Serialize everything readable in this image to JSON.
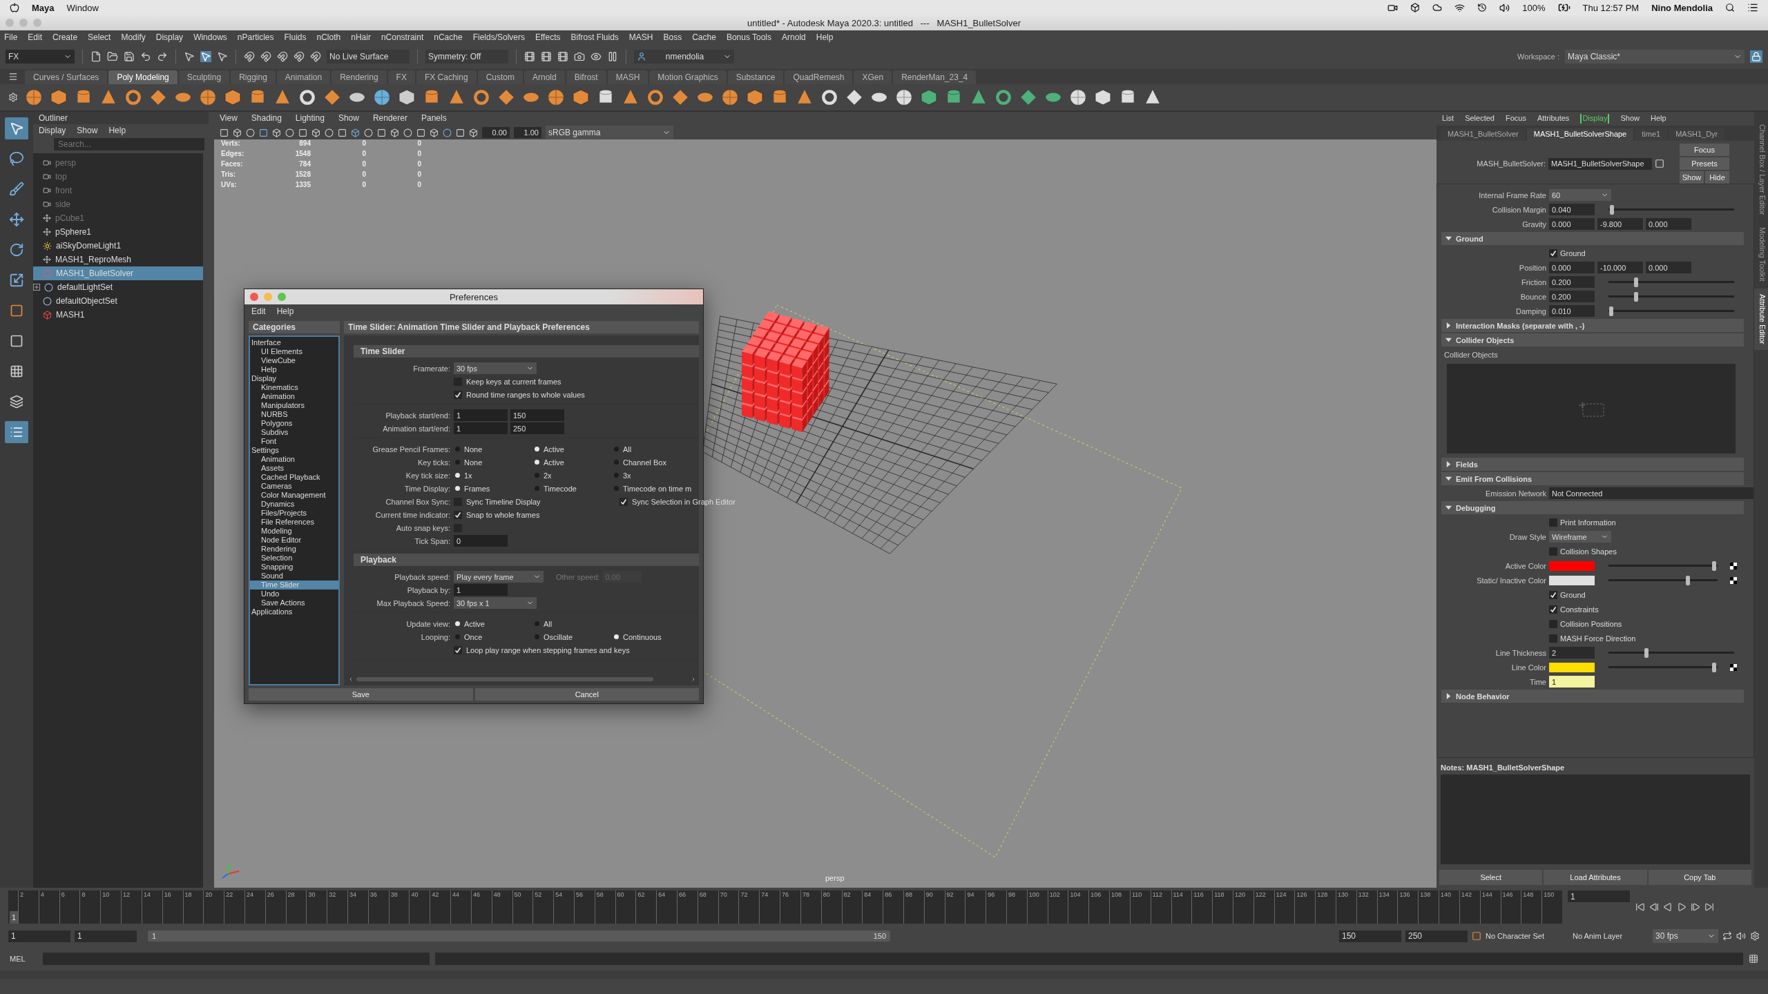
{
  "mac_menubar": {
    "app": "Maya",
    "menus": [
      "Window"
    ],
    "battery": "100%",
    "clock": "Thu 12:57 PM",
    "user": "Nino Mendolia"
  },
  "window": {
    "title": "untitled* - Autodesk Maya 2020.3: untitled   ---   MASH1_BulletSolver"
  },
  "menu_bar": [
    "File",
    "Edit",
    "Create",
    "Select",
    "Modify",
    "Display",
    "Windows",
    "nParticles",
    "Fluids",
    "nCloth",
    "nHair",
    "nConstraint",
    "nCache",
    "Fields/Solvers",
    "Effects",
    "Bifrost Fluids",
    "MASH",
    "Boss",
    "Cache",
    "Bonus Tools",
    "Arnold",
    "Help"
  ],
  "status_line": {
    "menu_set": "FX",
    "live_surface": "No Live Surface",
    "symmetry": "Symmetry: Off",
    "user": "nmendolia",
    "workspace_label": "Workspace :",
    "workspace": "Maya Classic*"
  },
  "shelf_tabs": [
    {
      "label": "Curves / Surfaces",
      "selected": false
    },
    {
      "label": "Poly Modeling",
      "selected": true
    },
    {
      "label": "Sculpting",
      "selected": false
    },
    {
      "label": "Rigging",
      "selected": false
    },
    {
      "label": "Animation",
      "selected": false
    },
    {
      "label": "Rendering",
      "selected": false
    },
    {
      "label": "FX",
      "selected": false
    },
    {
      "label": "FX Caching",
      "selected": false
    },
    {
      "label": "Custom",
      "selected": false
    },
    {
      "label": "Arnold",
      "selected": false
    },
    {
      "label": "Bifrost",
      "selected": false
    },
    {
      "label": "MASH",
      "selected": false
    },
    {
      "label": "Motion Graphics",
      "selected": false
    },
    {
      "label": "Substance",
      "selected": false
    },
    {
      "label": "QuadRemesh",
      "selected": false
    },
    {
      "label": "XGen",
      "selected": false
    },
    {
      "label": "RenderMan_23_4",
      "selected": false
    }
  ],
  "outliner": {
    "title": "Outliner",
    "menus": [
      "Display",
      "Show",
      "Help"
    ],
    "search_placeholder": "Search...",
    "items": [
      {
        "label": "persp",
        "kind": "camera",
        "hidden": true,
        "expandable": false,
        "selected": false
      },
      {
        "label": "top",
        "kind": "camera",
        "hidden": true,
        "expandable": false,
        "selected": false
      },
      {
        "label": "front",
        "kind": "camera",
        "hidden": true,
        "expandable": false,
        "selected": false
      },
      {
        "label": "side",
        "kind": "camera",
        "hidden": true,
        "expandable": false,
        "selected": false
      },
      {
        "label": "pCube1",
        "kind": "transform",
        "hidden": true,
        "expandable": false,
        "selected": false
      },
      {
        "label": "pSphere1",
        "kind": "transform",
        "hidden": false,
        "expandable": false,
        "selected": false
      },
      {
        "label": "aiSkyDomeLight1",
        "kind": "light",
        "hidden": false,
        "expandable": false,
        "selected": false
      },
      {
        "label": "MASH1_ReproMesh",
        "kind": "transform",
        "hidden": false,
        "expandable": false,
        "selected": false
      },
      {
        "label": "MASH1_BulletSolver",
        "kind": "solver",
        "hidden": false,
        "expandable": false,
        "selected": true
      },
      {
        "label": "defaultLightSet",
        "kind": "set",
        "hidden": false,
        "expandable": true,
        "selected": false
      },
      {
        "label": "defaultObjectSet",
        "kind": "set",
        "hidden": false,
        "expandable": false,
        "selected": false
      },
      {
        "label": "MASH1",
        "kind": "mash",
        "hidden": false,
        "expandable": false,
        "selected": false
      }
    ]
  },
  "viewport": {
    "menus": [
      "View",
      "Shading",
      "Lighting",
      "Show",
      "Renderer",
      "Panels"
    ],
    "exposure": "0.00",
    "gamma": "1.00",
    "color_space": "sRGB gamma",
    "camera": "persp",
    "stats": [
      {
        "label": "Verts:",
        "values": [
          "894",
          "0",
          "0"
        ]
      },
      {
        "label": "Edges:",
        "values": [
          "1548",
          "0",
          "0"
        ]
      },
      {
        "label": "Faces:",
        "values": [
          "784",
          "0",
          "0"
        ]
      },
      {
        "label": "Tris:",
        "values": [
          "1528",
          "0",
          "0"
        ]
      },
      {
        "label": "UVs:",
        "values": [
          "1335",
          "0",
          "0"
        ]
      }
    ]
  },
  "preferences": {
    "title": "Preferences",
    "menus": [
      "Edit",
      "Help"
    ],
    "categories_title": "Categories",
    "categories": [
      {
        "label": "Interface",
        "selected": false,
        "children": [
          {
            "label": "UI Elements",
            "selected": false
          },
          {
            "label": "ViewCube",
            "selected": false
          },
          {
            "label": "Help",
            "selected": false
          }
        ]
      },
      {
        "label": "Display",
        "selected": false,
        "children": [
          {
            "label": "Kinematics",
            "selected": false
          },
          {
            "label": "Animation",
            "selected": false
          },
          {
            "label": "Manipulators",
            "selected": false
          },
          {
            "label": "NURBS",
            "selected": false
          },
          {
            "label": "Polygons",
            "selected": false
          },
          {
            "label": "Subdivs",
            "selected": false
          },
          {
            "label": "Font",
            "selected": false
          }
        ]
      },
      {
        "label": "Settings",
        "selected": false,
        "children": [
          {
            "label": "Animation",
            "selected": false
          },
          {
            "label": "Assets",
            "selected": false
          },
          {
            "label": "Cached Playback",
            "selected": false
          },
          {
            "label": "Cameras",
            "selected": false
          },
          {
            "label": "Color Management",
            "selected": false
          },
          {
            "label": "Dynamics",
            "selected": false
          },
          {
            "label": "Files/Projects",
            "selected": false
          },
          {
            "label": "File References",
            "selected": false
          },
          {
            "label": "Modeling",
            "selected": false
          },
          {
            "label": "Node Editor",
            "selected": false
          },
          {
            "label": "Rendering",
            "selected": false
          },
          {
            "label": "Selection",
            "selected": false
          },
          {
            "label": "Snapping",
            "selected": false
          },
          {
            "label": "Sound",
            "selected": false
          },
          {
            "label": "Time Slider",
            "selected": true
          },
          {
            "label": "Undo",
            "selected": false
          },
          {
            "label": "Save Actions",
            "selected": false
          }
        ]
      },
      {
        "label": "Applications",
        "selected": false
      }
    ],
    "heading": "Time Slider: Animation Time Slider and Playback Preferences",
    "sections": [
      {
        "title": "Time Slider",
        "groups": [
          [
            {
              "kind": "dropdown",
              "label": "Framerate:",
              "value": "30 fps"
            },
            {
              "kind": "checks",
              "options": [
                {
                  "text": "Keep keys at current frames",
                  "checked": false
                }
              ]
            },
            {
              "kind": "checks",
              "options": [
                {
                  "text": "Round time ranges to whole values",
                  "checked": true
                }
              ]
            }
          ],
          [
            {
              "kind": "pair",
              "label": "Playback start/end:",
              "values": [
                "1",
                "150"
              ]
            },
            {
              "kind": "pair",
              "label": "Animation start/end:",
              "values": [
                "1",
                "250"
              ]
            }
          ],
          [
            {
              "kind": "radios",
              "label": "Grease Pencil Frames:",
              "options": [
                {
                  "text": "None",
                  "selected": false
                },
                {
                  "text": "Active",
                  "selected": true
                },
                {
                  "text": "All",
                  "selected": false
                }
              ]
            },
            {
              "kind": "radios",
              "label": "Key ticks:",
              "options": [
                {
                  "text": "None",
                  "selected": false
                },
                {
                  "text": "Active",
                  "selected": true
                },
                {
                  "text": "Channel Box",
                  "selected": false
                }
              ]
            },
            {
              "kind": "radios",
              "label": "Key tick size:",
              "options": [
                {
                  "text": "1x",
                  "selected": true
                },
                {
                  "text": "2x",
                  "selected": false
                },
                {
                  "text": "3x",
                  "selected": false
                }
              ]
            },
            {
              "kind": "radios",
              "label": "Time Display:",
              "options": [
                {
                  "text": "Frames",
                  "selected": true
                },
                {
                  "text": "Timecode",
                  "selected": false
                },
                {
                  "text": "Timecode on time m",
                  "selected": false
                }
              ]
            },
            {
              "kind": "checks",
              "label": "Channel Box Sync:",
              "options": [
                {
                  "text": "Sync Timeline Display",
                  "checked": false
                },
                {
                  "text": "Sync Selection in Graph Editor",
                  "checked": true
                }
              ]
            },
            {
              "kind": "checks",
              "label": "Current time indicator:",
              "options": [
                {
                  "text": "Snap to whole frames",
                  "checked": true
                }
              ]
            },
            {
              "kind": "checks",
              "label": "Auto snap keys:",
              "options": [
                {
                  "checked": false
                }
              ]
            },
            {
              "kind": "field",
              "label": "Tick Span:",
              "value": "0"
            }
          ]
        ]
      },
      {
        "title": "Playback",
        "groups": [
          [
            {
              "kind": "speed",
              "label": "Playback speed:",
              "value": "Play every frame",
              "other_label": "Other speed:",
              "other_value": "0.00"
            },
            {
              "kind": "field",
              "label": "Playback by:",
              "value": "1"
            },
            {
              "kind": "dropdown",
              "label": "Max Playback Speed:",
              "value": "30 fps x 1"
            }
          ],
          [
            {
              "kind": "radios",
              "label": "Update view:",
              "options": [
                {
                  "text": "Active",
                  "selected": true
                },
                {
                  "text": "All",
                  "selected": false
                }
              ]
            },
            {
              "kind": "radios",
              "label": "Looping:",
              "options": [
                {
                  "text": "Once",
                  "selected": false
                },
                {
                  "text": "Oscillate",
                  "selected": false
                },
                {
                  "text": "Continuous",
                  "selected": true
                }
              ]
            },
            {
              "kind": "checks",
              "options": [
                {
                  "text": "Loop play range when stepping frames and keys",
                  "checked": true
                }
              ]
            }
          ]
        ]
      }
    ],
    "buttons": [
      "Save",
      "Cancel"
    ]
  },
  "attribute_editor": {
    "menus": [
      {
        "label": "List",
        "active": false
      },
      {
        "label": "Selected",
        "active": false
      },
      {
        "label": "Focus",
        "active": false
      },
      {
        "label": "Attributes",
        "active": false
      },
      {
        "label": "Display",
        "active": true
      },
      {
        "label": "Show",
        "active": false
      },
      {
        "label": "Help",
        "active": false
      }
    ],
    "tabs": [
      {
        "label": "MASH1_BulletSolver",
        "selected": false
      },
      {
        "label": "MASH1_BulletSolverShape",
        "selected": true
      },
      {
        "label": "time1",
        "selected": false
      },
      {
        "label": "MASH1_Dyr",
        "selected": false
      }
    ],
    "node_label": "MASH_BulletSolver:",
    "node_value": "MASH1_BulletSolverShape",
    "buttons": [
      "Focus",
      "Presets",
      "Show",
      "Hide"
    ],
    "rows": [
      {
        "kind": "dropdown",
        "label": "Internal Frame Rate",
        "value": "60"
      },
      {
        "kind": "slider",
        "label": "Collision Margin",
        "value": "0.040",
        "level": 0.03
      },
      {
        "kind": "vector",
        "label": "Gravity",
        "values": [
          "0.000",
          "-9.800",
          "0.000"
        ]
      },
      {
        "kind": "section",
        "label": "Ground",
        "expanded": true
      },
      {
        "kind": "check",
        "label": "Ground",
        "checked": true
      },
      {
        "kind": "vector",
        "label": "Position",
        "values": [
          "0.000",
          "-10.000",
          "0.000"
        ]
      },
      {
        "kind": "slider",
        "label": "Friction",
        "value": "0.200",
        "level": 0.22
      },
      {
        "kind": "slider",
        "label": "Bounce",
        "value": "0.200",
        "level": 0.22
      },
      {
        "kind": "slider",
        "label": "Damping",
        "value": "0.010",
        "level": 0.02
      },
      {
        "kind": "section",
        "label": "Interaction Masks (separate with , -)",
        "expanded": false
      },
      {
        "kind": "section",
        "label": "Collider Objects",
        "expanded": true
      },
      {
        "kind": "list",
        "label": "Collider Objects"
      },
      {
        "kind": "section",
        "label": "Fields",
        "expanded": false
      },
      {
        "kind": "section",
        "label": "Emit From Collisions",
        "expanded": true
      },
      {
        "kind": "field",
        "label": "Emission Network",
        "value": "Not Connected"
      },
      {
        "kind": "section",
        "label": "Debugging",
        "expanded": true
      },
      {
        "kind": "check",
        "label": "Print Information",
        "checked": false
      },
      {
        "kind": "dropdown",
        "label": "Draw Style",
        "value": "Wireframe"
      },
      {
        "kind": "check",
        "label": "Collision Shapes",
        "checked": false
      },
      {
        "kind": "color",
        "label": "Active Color",
        "color": "#ff0000",
        "level": 0.97
      },
      {
        "kind": "color",
        "label": "Static/ Inactive Color",
        "color": "#e0e0e0",
        "level": 0.73
      },
      {
        "kind": "check",
        "label": "Ground",
        "checked": true
      },
      {
        "kind": "check",
        "label": "Constraints",
        "checked": true
      },
      {
        "kind": "check",
        "label": "Collision Positions",
        "checked": false
      },
      {
        "kind": "check",
        "label": "MASH Force Direction",
        "checked": false
      },
      {
        "kind": "slider",
        "label": "Line Thickness",
        "value": "2",
        "level": 0.3
      },
      {
        "kind": "color",
        "label": "Line Color",
        "color": "#ffdd00",
        "level": 0.97
      },
      {
        "kind": "time",
        "label": "Time",
        "value": "1"
      },
      {
        "kind": "section",
        "label": "Node Behavior",
        "expanded": false
      }
    ],
    "notes_label": "Notes:  MASH1_BulletSolverShape",
    "bottom_buttons": [
      "Select",
      "Load Attributes",
      "Copy Tab"
    ]
  },
  "side_tabs": [
    {
      "label": "Channel Box / Layer Editor",
      "selected": false
    },
    {
      "label": "Modeling Toolkit",
      "selected": false
    },
    {
      "label": "Attribute Editor",
      "selected": true
    }
  ],
  "timeline": {
    "ticks": [
      "2",
      "4",
      "6",
      "8",
      "10",
      "12",
      "14",
      "16",
      "18",
      "20",
      "22",
      "24",
      "26",
      "28",
      "30",
      "32",
      "34",
      "36",
      "38",
      "40",
      "42",
      "44",
      "46",
      "48",
      "50",
      "52",
      "54",
      "56",
      "58",
      "60",
      "62",
      "64",
      "66",
      "68",
      "70",
      "72",
      "74",
      "76",
      "78",
      "80",
      "82",
      "84",
      "86",
      "88",
      "90",
      "92",
      "94",
      "96",
      "98",
      "100",
      "102",
      "104",
      "106",
      "108",
      "110",
      "112",
      "114",
      "116",
      "118",
      "120",
      "122",
      "124",
      "126",
      "128",
      "130",
      "132",
      "134",
      "136",
      "138",
      "140",
      "142",
      "144",
      "146",
      "148",
      "150"
    ],
    "current": "1",
    "current_field": "1"
  },
  "range": {
    "start": "1",
    "playback_start": "1",
    "slider_start": "1",
    "slider_end": "150",
    "playback_end": "150",
    "end": "250",
    "character_set": "No Character Set",
    "anim_layer": "No Anim Layer",
    "fps": "30 fps"
  },
  "command_line": {
    "label": "MEL"
  }
}
